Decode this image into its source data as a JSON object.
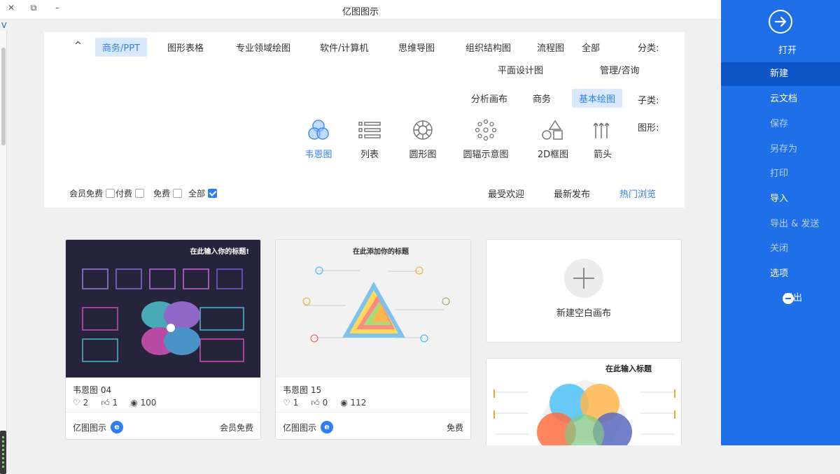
{
  "window": {
    "title": "亿图图示",
    "left_label": "VC ▾"
  },
  "filters": {
    "category_label": "分类:",
    "categories": [
      "全部",
      "流程图",
      "组织结构图",
      "思维导图",
      "软件/计算机",
      "专业领域绘图",
      "图形表格",
      "商务/PPT",
      "管理/咨询",
      "平面设计图"
    ],
    "active_category": "商务/PPT",
    "subcategory_label": "子类:",
    "subcategories": [
      "基本绘图",
      "商务",
      "分析画布"
    ],
    "active_subcategory": "基本绘图",
    "shape_label": "图形:",
    "shapes": [
      "箭头",
      "2D框图",
      "圆辐示意图",
      "圆形图",
      "列表",
      "韦恩图"
    ],
    "active_shape": "韦恩图",
    "collapse_icon": "chevron-up-icon"
  },
  "sortbar": {
    "sorts": [
      "热门浏览",
      "最新发布",
      "最受欢迎"
    ],
    "active_sort": "热门浏览",
    "checkboxes": [
      {
        "label": "全部",
        "checked": true
      },
      {
        "label": "免费",
        "checked": false
      },
      {
        "label": "付费",
        "checked": false
      },
      {
        "label": "会员免费",
        "checked": false
      }
    ]
  },
  "cards": [
    {
      "name": "韦恩图 04",
      "views": "100",
      "likes": "1",
      "favorites": "2",
      "brand": "亿图图示",
      "price": "会员免费",
      "thumb_title": "在此输入你的标题!"
    },
    {
      "name": "韦恩图 15",
      "views": "112",
      "likes": "0",
      "favorites": "1",
      "brand": "亿图图示",
      "price": "免费",
      "thumb_title": "在此添加你的标题"
    },
    {
      "thumb_title": "在此输入标题"
    }
  ],
  "new_canvas": {
    "label": "新建空白画布"
  },
  "sidebar": {
    "open_label": "打开",
    "items": [
      {
        "label": "新建",
        "active": true,
        "dim": false
      },
      {
        "label": "云文档",
        "active": false,
        "dim": false
      },
      {
        "label": "保存",
        "active": false,
        "dim": true
      },
      {
        "label": "另存为",
        "active": false,
        "dim": true
      },
      {
        "label": "打印",
        "active": false,
        "dim": true
      },
      {
        "label": "导入",
        "active": false,
        "dim": false
      },
      {
        "label": "导出 & 发送",
        "active": false,
        "dim": true
      },
      {
        "label": "关闭",
        "active": false,
        "dim": true
      },
      {
        "label": "选项",
        "active": false,
        "dim": false
      },
      {
        "label": "退出",
        "active": false,
        "dim": false
      }
    ]
  },
  "colors": {
    "accent": "#2d7ff9",
    "sidebar": "#1e6fe8",
    "sidebar_active": "#0d55c7"
  }
}
